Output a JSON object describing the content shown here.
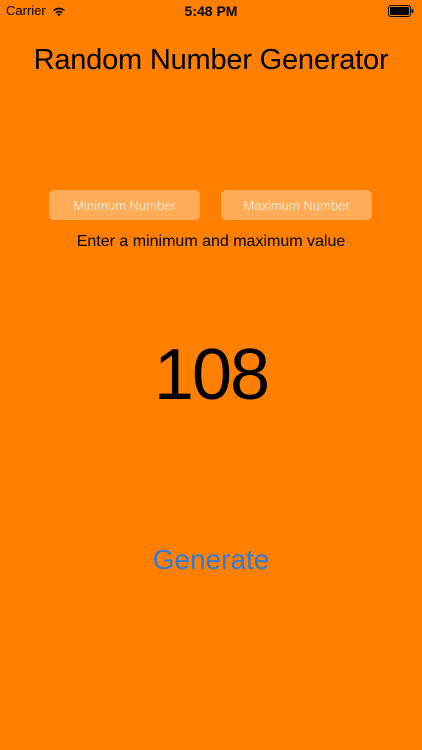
{
  "status_bar": {
    "carrier": "Carrier",
    "time": "5:48 PM",
    "wifi_icon": "wifi-icon",
    "battery_icon": "battery-icon"
  },
  "app": {
    "title": "Random Number Generator",
    "min_field": {
      "value": "",
      "placeholder": "Minimum Number"
    },
    "max_field": {
      "value": "",
      "placeholder": "Maximum Number"
    },
    "hint": "Enter a minimum and maximum value",
    "result": "108",
    "generate_label": "Generate"
  },
  "colors": {
    "background": "#FF8000",
    "button_text": "#2F7BD6",
    "text": "#000000"
  }
}
